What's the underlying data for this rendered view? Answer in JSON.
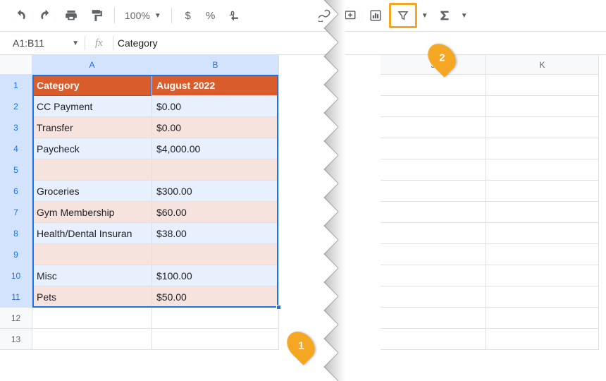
{
  "toolbar": {
    "zoom": "100%",
    "currency_symbol": "$",
    "percent_symbol": "%"
  },
  "namebox": {
    "range": "A1:B11"
  },
  "formula_bar": {
    "value": "Category"
  },
  "columns": {
    "left": [
      "A",
      "B"
    ],
    "right": [
      "J",
      "K"
    ]
  },
  "row_numbers": [
    1,
    2,
    3,
    4,
    5,
    6,
    7,
    8,
    9,
    10,
    11,
    12,
    13
  ],
  "data": {
    "header": {
      "a": "Category",
      "b": "August 2022"
    },
    "rows": [
      {
        "a": "CC Payment",
        "b": "$0.00"
      },
      {
        "a": "Transfer",
        "b": "$0.00"
      },
      {
        "a": "Paycheck",
        "b": "$4,000.00"
      },
      {
        "a": "",
        "b": ""
      },
      {
        "a": "Groceries",
        "b": "$300.00"
      },
      {
        "a": "Gym Membership",
        "b": "$60.00"
      },
      {
        "a": "Health/Dental Insuran",
        "b": "$38.00"
      },
      {
        "a": "",
        "b": ""
      },
      {
        "a": "Misc",
        "b": "$100.00"
      },
      {
        "a": "Pets",
        "b": "$50.00"
      }
    ]
  },
  "callouts": {
    "one": "1",
    "two": "2"
  },
  "col_widths": {
    "A": 170,
    "B": 180,
    "J": 150,
    "K": 160
  }
}
